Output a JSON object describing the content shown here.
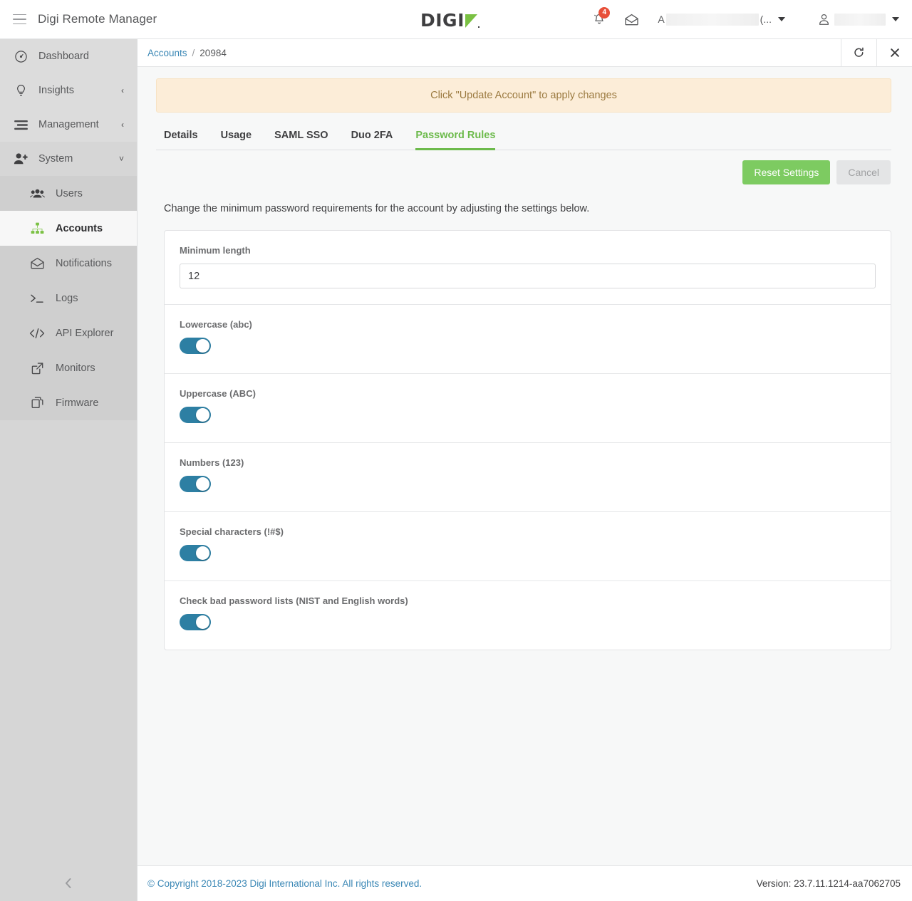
{
  "header": {
    "app_title": "Digi Remote Manager",
    "logo_text": "DIGI",
    "menu_icon": "hamburger-icon",
    "notifications_badge": "4",
    "account_prefix": "A",
    "account_suffix": "(...",
    "user_name": ""
  },
  "sidebar": {
    "items": [
      {
        "label": "Dashboard",
        "icon": "gauge-icon",
        "chevron": ""
      },
      {
        "label": "Insights",
        "icon": "lightbulb-icon",
        "chevron": "‹"
      },
      {
        "label": "Management",
        "icon": "sliders-icon",
        "chevron": "‹"
      },
      {
        "label": "System",
        "icon": "user-plus-icon",
        "chevron": "˅"
      }
    ],
    "subitems": [
      {
        "label": "Users",
        "icon": "users-icon",
        "active": false
      },
      {
        "label": "Accounts",
        "icon": "sitemap-icon",
        "active": true
      },
      {
        "label": "Notifications",
        "icon": "envelope-open-icon",
        "active": false
      },
      {
        "label": "Logs",
        "icon": "terminal-icon",
        "active": false
      },
      {
        "label": "API Explorer",
        "icon": "code-icon",
        "active": false
      },
      {
        "label": "Monitors",
        "icon": "external-link-icon",
        "active": false
      },
      {
        "label": "Firmware",
        "icon": "copy-icon",
        "active": false
      }
    ],
    "collapse_icon": "chevron-left-icon"
  },
  "breadcrumb": {
    "root": "Accounts",
    "separator": "/",
    "current": "20984",
    "refresh_icon": "refresh-icon",
    "close_icon": "close-icon"
  },
  "banner": {
    "message": "Click \"Update Account\" to apply changes"
  },
  "tabs": [
    {
      "label": "Details",
      "active": false
    },
    {
      "label": "Usage",
      "active": false
    },
    {
      "label": "SAML SSO",
      "active": false
    },
    {
      "label": "Duo 2FA",
      "active": false
    },
    {
      "label": "Password Rules",
      "active": true
    }
  ],
  "actions": {
    "reset_label": "Reset Settings",
    "cancel_label": "Cancel"
  },
  "main": {
    "description": "Change the minimum password requirements for the account by adjusting the settings below.",
    "min_length": {
      "label": "Minimum length",
      "value": "12"
    },
    "rules": [
      {
        "label": "Lowercase (abc)",
        "enabled": true
      },
      {
        "label": "Uppercase (ABC)",
        "enabled": true
      },
      {
        "label": "Numbers (123)",
        "enabled": true
      },
      {
        "label": "Special characters (!#$)",
        "enabled": true
      },
      {
        "label": "Check bad password lists (NIST and English words)",
        "enabled": true
      }
    ]
  },
  "footer": {
    "copyright": "© Copyright 2018-2023 Digi International Inc. All rights reserved.",
    "version": "Version: 23.7.11.1214-aa7062705"
  },
  "colors": {
    "brand_green": "#7ac143",
    "tab_active": "#6cba4b",
    "toggle_on": "#2d7fa3",
    "link": "#3a87b5",
    "banner_bg": "#fcedd8",
    "badge_red": "#e8503a"
  }
}
